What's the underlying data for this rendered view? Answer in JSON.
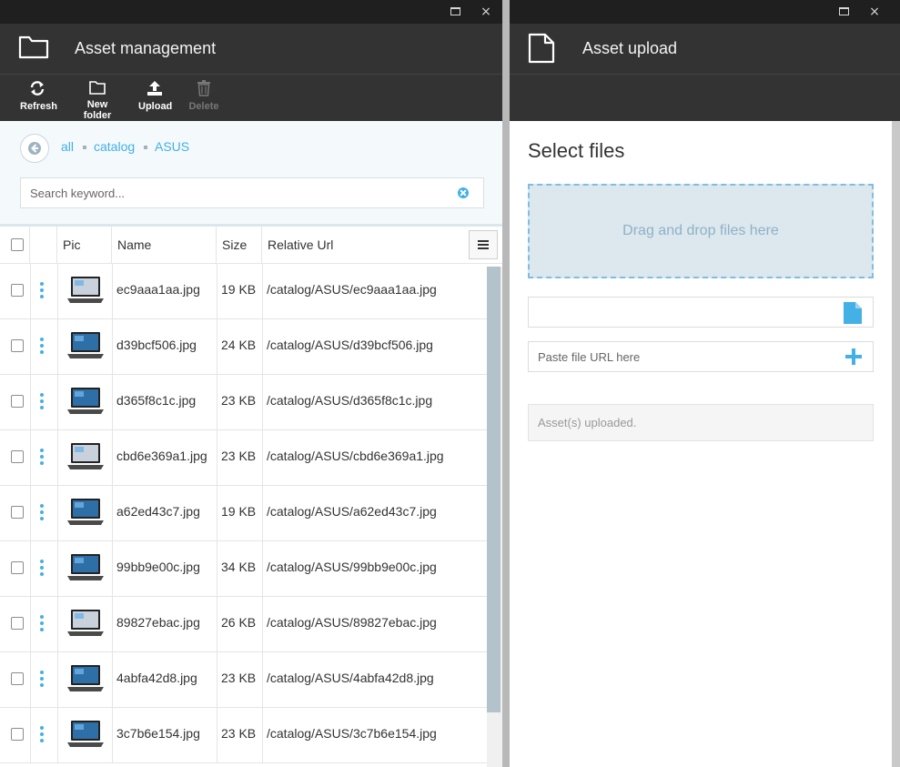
{
  "left_blade": {
    "title": "Asset management",
    "header_icon": "folder-icon",
    "window_buttons": {
      "maximize": "maximize-icon",
      "close": "×"
    },
    "toolbar": [
      {
        "label": "Refresh",
        "icon": "refresh-icon",
        "disabled": false
      },
      {
        "label": "New folder",
        "icon": "folder-icon",
        "disabled": false
      },
      {
        "label": "Upload",
        "icon": "upload-icon",
        "disabled": false
      },
      {
        "label": "Delete",
        "icon": "trash-icon",
        "disabled": true
      }
    ],
    "breadcrumb": [
      "all",
      "catalog",
      "ASUS"
    ],
    "search": {
      "placeholder": "Search keyword...",
      "value": ""
    },
    "columns": [
      "Pic",
      "Name",
      "Size",
      "Relative Url"
    ],
    "rows": [
      {
        "name": "ec9aaa1aa.jpg",
        "size": "19 KB",
        "url": "/catalog/ASUS/ec9aaa1aa.jpg"
      },
      {
        "name": "d39bcf506.jpg",
        "size": "24 KB",
        "url": "/catalog/ASUS/d39bcf506.jpg"
      },
      {
        "name": "d365f8c1c.jpg",
        "size": "23 KB",
        "url": "/catalog/ASUS/d365f8c1c.jpg"
      },
      {
        "name": "cbd6e369a1.jpg",
        "size": "23 KB",
        "url": "/catalog/ASUS/cbd6e369a1.jpg"
      },
      {
        "name": "a62ed43c7.jpg",
        "size": "19 KB",
        "url": "/catalog/ASUS/a62ed43c7.jpg"
      },
      {
        "name": "99bb9e00c.jpg",
        "size": "34 KB",
        "url": "/catalog/ASUS/99bb9e00c.jpg"
      },
      {
        "name": "89827ebac.jpg",
        "size": "26 KB",
        "url": "/catalog/ASUS/89827ebac.jpg"
      },
      {
        "name": "4abfa42d8.jpg",
        "size": "23 KB",
        "url": "/catalog/ASUS/4abfa42d8.jpg"
      },
      {
        "name": "3c7b6e154.jpg",
        "size": "23 KB",
        "url": "/catalog/ASUS/3c7b6e154.jpg"
      }
    ]
  },
  "right_blade": {
    "title": "Asset upload",
    "header_icon": "file-icon",
    "window_buttons": {
      "maximize": "maximize-icon",
      "close": "×"
    },
    "section_title": "Select files",
    "dropzone_text": "Drag and drop files here",
    "file_input": {
      "value": "",
      "placeholder": ""
    },
    "url_input": {
      "placeholder": "Paste file URL here",
      "value": ""
    },
    "status_text": "Asset(s) uploaded."
  },
  "colors": {
    "accent": "#43b0e6",
    "header_bg": "#333333",
    "window_bar": "#1f1f1f"
  }
}
